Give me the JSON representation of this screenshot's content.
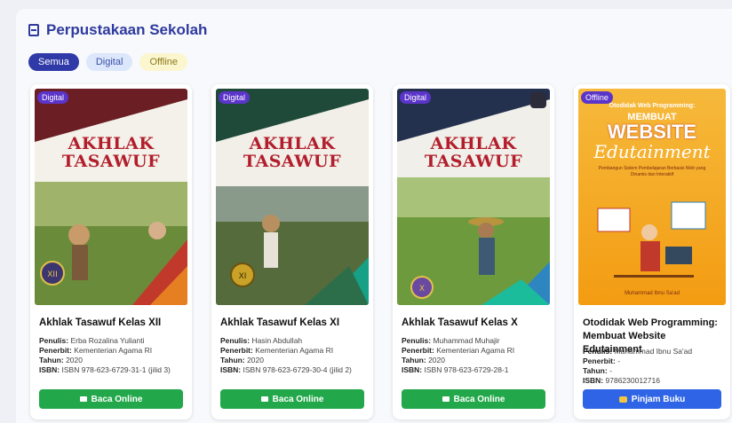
{
  "header": {
    "title": "Perpustakaan Sekolah",
    "icon": "book-icon"
  },
  "filters": [
    {
      "label": "Semua",
      "active": true
    },
    {
      "label": "Digital",
      "active": false
    },
    {
      "label": "Offline",
      "active": false
    }
  ],
  "labels": {
    "penulis": "Penulis:",
    "penerbit": "Penerbit:",
    "tahun": "Tahun:",
    "isbn": "ISBN:"
  },
  "books": [
    {
      "badge": "Digital",
      "cover_title_1": "AKHLAK",
      "cover_title_2": "TASAWUF",
      "cover_grade": "XII",
      "title": "Akhlak Tasawuf Kelas XII",
      "penulis": "Erba Rozalina Yulianti",
      "penerbit": "Kementerian Agama RI",
      "tahun": "2020",
      "isbn": "ISBN 978-623-6729-31-1 (jilid 3)",
      "button": "Baca Online"
    },
    {
      "badge": "Digital",
      "cover_title_1": "AKHLAK",
      "cover_title_2": "TASAWUF",
      "cover_grade": "XI",
      "title": "Akhlak Tasawuf Kelas XI",
      "penulis": "Hasin Abdullah",
      "penerbit": "Kementerian Agama RI",
      "tahun": "2020",
      "isbn": "ISBN 978-623-6729-30-4 (jilid 2)",
      "button": "Baca Online"
    },
    {
      "badge": "Digital",
      "cover_title_1": "AKHLAK",
      "cover_title_2": "TASAWUF",
      "cover_grade": "X",
      "title": "Akhlak Tasawuf Kelas X",
      "penulis": "Muhammad Muhajir",
      "penerbit": "Kementerian Agama RI",
      "tahun": "2020",
      "isbn": "ISBN 978-623-6729-28-1",
      "button": "Baca Online"
    },
    {
      "badge": "Offline",
      "cover_line1": "Otodidak Web Programming:",
      "cover_line2": "MEMBUAT",
      "cover_line3": "WEBSITE",
      "cover_line4": "Edutainment",
      "cover_sub": "Pembangun Sistem Pembelajaran Berbasis Web yang Dinamis dan Interaktif",
      "cover_author": "Muhammad Ibnu Sa'ad",
      "title": "Otodidak Web Programming: Membuat Website Edutainment",
      "penulis": "Muhammad Ibnu Sa'ad",
      "penerbit": "-",
      "tahun": "-",
      "isbn": "9786230012716",
      "button": "Pinjam Buku"
    }
  ],
  "colors": {
    "accent": "#2f39a8",
    "green": "#22a84a",
    "blue": "#2f64e6",
    "badge": "#5b35c9"
  }
}
